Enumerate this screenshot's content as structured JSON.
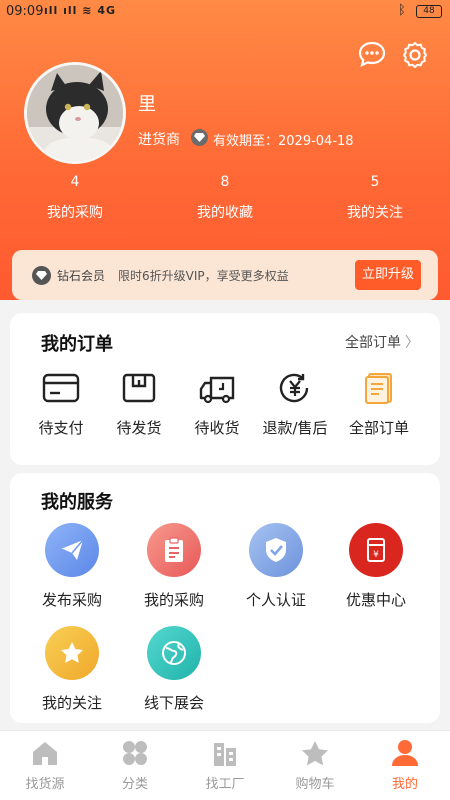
{
  "status_bar": {
    "time": "09:09",
    "signal": "᪆ᵢₗ ᵢₗ",
    "battery": "48"
  },
  "user": {
    "name": "里",
    "role": "进货商",
    "validity": "有效期至：2029-04-18"
  },
  "stats": [
    {
      "count": "4",
      "label": "我的采购"
    },
    {
      "count": "8",
      "label": "我的收藏"
    },
    {
      "count": "5",
      "label": "我的关注"
    }
  ],
  "vip": {
    "name": "钻石会员",
    "desc": "限时6折升级VIP，享受更多权益",
    "button": "立即升级"
  },
  "orders": {
    "title": "我的订单",
    "all_link": "全部订单",
    "items": [
      {
        "label": "待支付",
        "icon": "card-icon"
      },
      {
        "label": "待发货",
        "icon": "box-icon"
      },
      {
        "label": "待收货",
        "icon": "truck-icon"
      },
      {
        "label": "退款/售后",
        "icon": "refund-icon"
      },
      {
        "label": "全部订单",
        "icon": "order-list-icon"
      }
    ]
  },
  "services": {
    "title": "我的服务",
    "items": [
      {
        "label": "发布采购",
        "icon": "paper-plane-icon",
        "color": "#6e9bf0"
      },
      {
        "label": "我的采购",
        "icon": "clipboard-icon",
        "color": "#f07575"
      },
      {
        "label": "个人认证",
        "icon": "shield-check-icon",
        "color": "#7fa6e8"
      },
      {
        "label": "优惠中心",
        "icon": "coupon-icon",
        "color": "#d9271f"
      },
      {
        "label": "我的关注",
        "icon": "star-icon",
        "color": "#f2b830"
      },
      {
        "label": "线下展会",
        "icon": "globe-icon",
        "color": "#2fc4bd"
      }
    ]
  },
  "tabs": [
    {
      "label": "找货源",
      "icon": "home-icon"
    },
    {
      "label": "分类",
      "icon": "grid-icon"
    },
    {
      "label": "找工厂",
      "icon": "factory-icon"
    },
    {
      "label": "购物车",
      "icon": "star-icon"
    },
    {
      "label": "我的",
      "icon": "person-icon",
      "active": true
    }
  ],
  "colors": {
    "accent": "#ff6a36",
    "vip_bg": "#fbe6d6",
    "tab_inactive": "#999999"
  }
}
